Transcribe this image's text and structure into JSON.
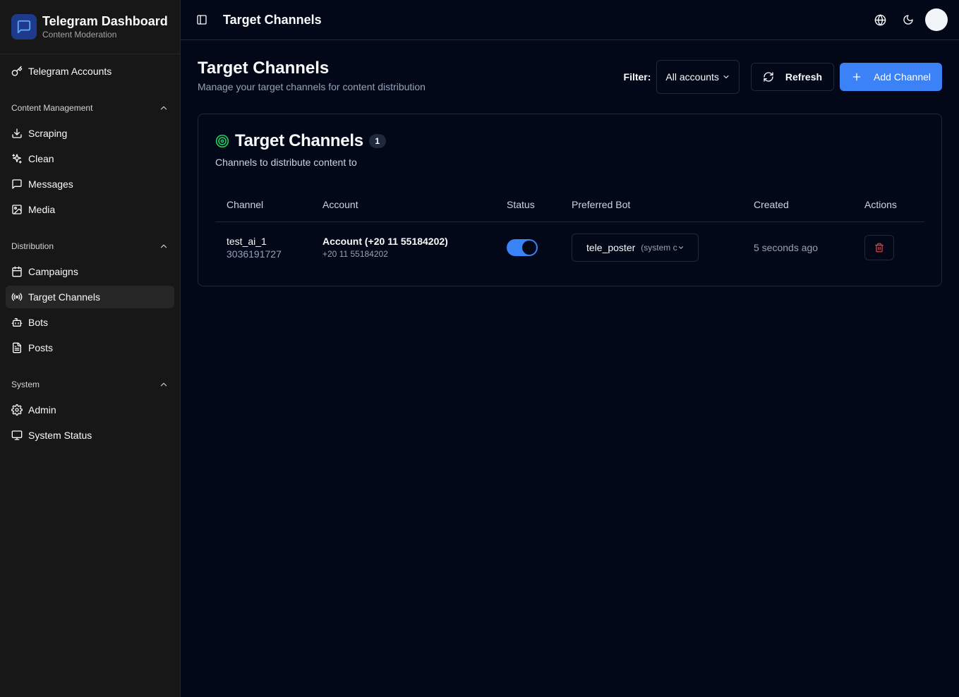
{
  "brand": {
    "title": "Telegram Dashboard",
    "subtitle": "Content Moderation"
  },
  "sidebar": {
    "top_item": {
      "label": "Telegram Accounts",
      "icon": "key-icon"
    },
    "groups": [
      {
        "label": "Content Management",
        "items": [
          {
            "label": "Scraping",
            "icon": "download-icon"
          },
          {
            "label": "Clean",
            "icon": "sparkles-icon"
          },
          {
            "label": "Messages",
            "icon": "message-square-icon"
          },
          {
            "label": "Media",
            "icon": "image-icon"
          }
        ]
      },
      {
        "label": "Distribution",
        "items": [
          {
            "label": "Campaigns",
            "icon": "calendar-icon"
          },
          {
            "label": "Target Channels",
            "icon": "radio-icon",
            "active": true
          },
          {
            "label": "Bots",
            "icon": "bot-icon"
          },
          {
            "label": "Posts",
            "icon": "file-text-icon"
          }
        ]
      },
      {
        "label": "System",
        "items": [
          {
            "label": "Admin",
            "icon": "settings-icon"
          },
          {
            "label": "System Status",
            "icon": "monitor-icon"
          }
        ]
      }
    ]
  },
  "topbar": {
    "title": "Target Channels"
  },
  "page": {
    "title": "Target Channels",
    "subtitle": "Manage your target channels for content distribution",
    "filter_label": "Filter:",
    "filter_value": "All accounts",
    "refresh_label": "Refresh",
    "add_label": "Add Channel"
  },
  "card": {
    "title": "Target Channels",
    "count": "1",
    "subtitle": "Channels to distribute content to",
    "columns": [
      "Channel",
      "Account",
      "Status",
      "Preferred Bot",
      "Created",
      "Actions"
    ],
    "rows": [
      {
        "channel_name": "test_ai_1",
        "channel_id": "3036191727",
        "account_name": "Account (+20 11 55184202)",
        "account_phone": "+20 11 55184202",
        "status_on": true,
        "bot_name": "tele_poster",
        "bot_meta": "(system c",
        "created": "5 seconds ago"
      }
    ]
  },
  "colors": {
    "accent": "#3b82f6",
    "danger": "#ef4444",
    "success": "#22c55e"
  }
}
